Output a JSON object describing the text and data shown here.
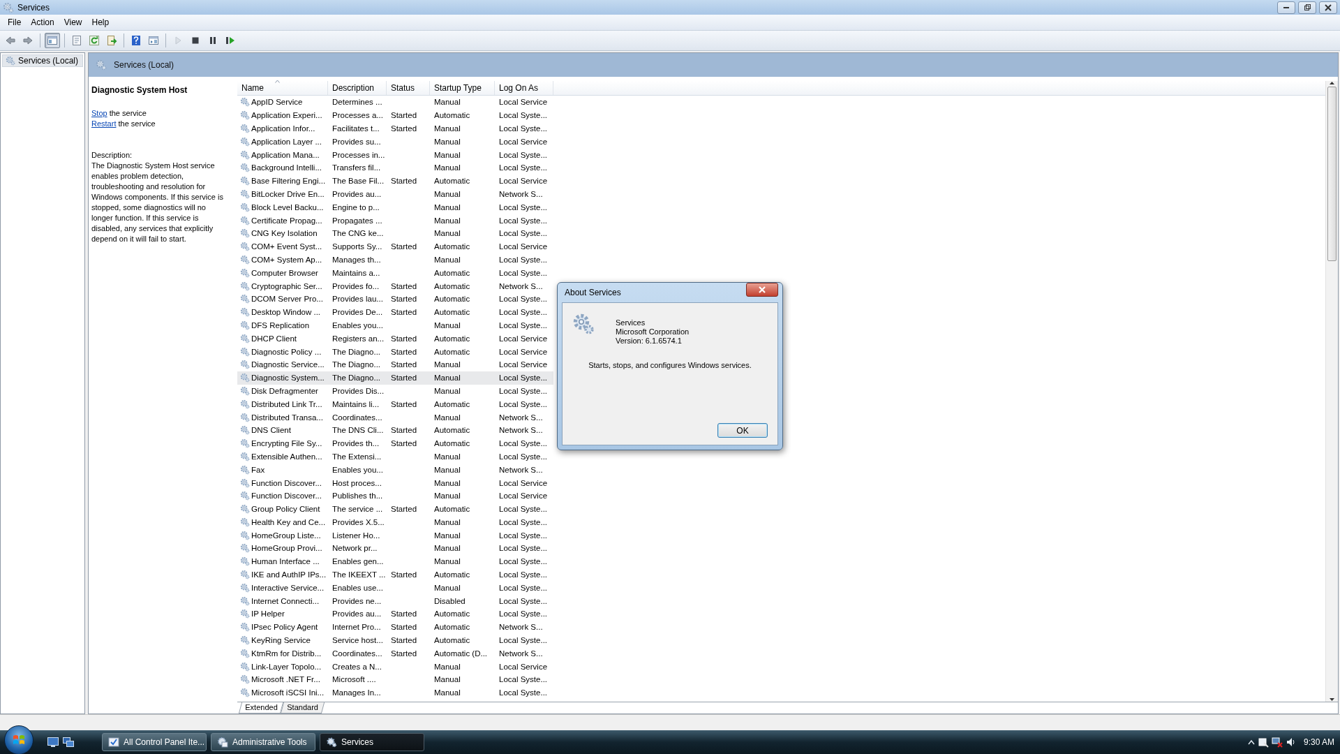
{
  "window": {
    "title": "Services"
  },
  "menu": [
    "File",
    "Action",
    "View",
    "Help"
  ],
  "toolbar": [
    {
      "kind": "back",
      "pressed": false,
      "disabled": false
    },
    {
      "kind": "forward",
      "pressed": false,
      "disabled": false
    },
    {
      "kind": "separator"
    },
    {
      "kind": "tree",
      "pressed": true,
      "disabled": false
    },
    {
      "kind": "separator"
    },
    {
      "kind": "properties",
      "pressed": false,
      "disabled": false
    },
    {
      "kind": "refresh",
      "pressed": false,
      "disabled": false
    },
    {
      "kind": "export",
      "pressed": false,
      "disabled": false
    },
    {
      "kind": "separator"
    },
    {
      "kind": "help",
      "pressed": false,
      "disabled": false
    },
    {
      "kind": "view",
      "pressed": false,
      "disabled": false
    },
    {
      "kind": "separator"
    },
    {
      "kind": "play",
      "pressed": false,
      "disabled": true
    },
    {
      "kind": "stop",
      "pressed": false,
      "disabled": false
    },
    {
      "kind": "pause",
      "pressed": false,
      "disabled": false
    },
    {
      "kind": "restart",
      "pressed": false,
      "disabled": false
    }
  ],
  "tree": {
    "items": [
      {
        "label": "Services (Local)",
        "selected": true
      }
    ]
  },
  "panel": {
    "title": "Services (Local)"
  },
  "detail": {
    "heading": "Diagnostic System Host",
    "actions": [
      {
        "link": "Stop",
        "text": "the service"
      },
      {
        "link": "Restart",
        "text": "the service"
      }
    ],
    "description_label": "Description:",
    "description": "The Diagnostic System Host service enables problem detection, troubleshooting and resolution for Windows components. If this service is stopped, some diagnostics will no longer function. If this service is disabled, any services that explicitly depend on it will fail to start."
  },
  "table": {
    "columns": [
      {
        "label": "Name",
        "sorted": true
      },
      {
        "label": "Description",
        "sorted": false
      },
      {
        "label": "Status",
        "sorted": false
      },
      {
        "label": "Startup Type",
        "sorted": false
      },
      {
        "label": "Log On As",
        "sorted": false
      }
    ],
    "rows": [
      {
        "name": "AppID Service",
        "description": "Determines ...",
        "startup_type": "Manual",
        "log_on_as": "Local Service",
        "selected": false
      },
      {
        "name": "Application Experi...",
        "description": "Processes a...",
        "status": "Started",
        "startup_type": "Automatic",
        "log_on_as": "Local Syste...",
        "selected": false
      },
      {
        "name": "Application Infor...",
        "description": "Facilitates t...",
        "status": "Started",
        "startup_type": "Manual",
        "log_on_as": "Local Syste...",
        "selected": false
      },
      {
        "name": "Application Layer ...",
        "description": "Provides su...",
        "startup_type": "Manual",
        "log_on_as": "Local Service",
        "selected": false
      },
      {
        "name": "Application Mana...",
        "description": "Processes in...",
        "startup_type": "Manual",
        "log_on_as": "Local Syste...",
        "selected": false
      },
      {
        "name": "Background Intelli...",
        "description": "Transfers fil...",
        "startup_type": "Manual",
        "log_on_as": "Local Syste...",
        "selected": false
      },
      {
        "name": "Base Filtering Engi...",
        "description": "The Base Fil...",
        "status": "Started",
        "startup_type": "Automatic",
        "log_on_as": "Local Service",
        "selected": false
      },
      {
        "name": "BitLocker Drive En...",
        "description": "Provides au...",
        "startup_type": "Manual",
        "log_on_as": "Network S...",
        "selected": false
      },
      {
        "name": "Block Level Backu...",
        "description": "Engine to p...",
        "startup_type": "Manual",
        "log_on_as": "Local Syste...",
        "selected": false
      },
      {
        "name": "Certificate Propag...",
        "description": "Propagates ...",
        "startup_type": "Manual",
        "log_on_as": "Local Syste...",
        "selected": false
      },
      {
        "name": "CNG Key Isolation",
        "description": "The CNG ke...",
        "startup_type": "Manual",
        "log_on_as": "Local Syste...",
        "selected": false
      },
      {
        "name": "COM+ Event Syst...",
        "description": "Supports Sy...",
        "status": "Started",
        "startup_type": "Automatic",
        "log_on_as": "Local Service",
        "selected": false
      },
      {
        "name": "COM+ System Ap...",
        "description": "Manages th...",
        "startup_type": "Manual",
        "log_on_as": "Local Syste...",
        "selected": false
      },
      {
        "name": "Computer Browser",
        "description": "Maintains a...",
        "startup_type": "Automatic",
        "log_on_as": "Local Syste...",
        "selected": false
      },
      {
        "name": "Cryptographic Ser...",
        "description": "Provides fo...",
        "status": "Started",
        "startup_type": "Automatic",
        "log_on_as": "Network S...",
        "selected": false
      },
      {
        "name": "DCOM Server Pro...",
        "description": "Provides lau...",
        "status": "Started",
        "startup_type": "Automatic",
        "log_on_as": "Local Syste...",
        "selected": false
      },
      {
        "name": "Desktop Window ...",
        "description": "Provides De...",
        "status": "Started",
        "startup_type": "Automatic",
        "log_on_as": "Local Syste...",
        "selected": false
      },
      {
        "name": "DFS Replication",
        "description": "Enables you...",
        "startup_type": "Manual",
        "log_on_as": "Local Syste...",
        "selected": false
      },
      {
        "name": "DHCP Client",
        "description": "Registers an...",
        "status": "Started",
        "startup_type": "Automatic",
        "log_on_as": "Local Service",
        "selected": false
      },
      {
        "name": "Diagnostic Policy ...",
        "description": "The Diagno...",
        "status": "Started",
        "startup_type": "Automatic",
        "log_on_as": "Local Service",
        "selected": false
      },
      {
        "name": "Diagnostic Service...",
        "description": "The Diagno...",
        "status": "Started",
        "startup_type": "Manual",
        "log_on_as": "Local Service",
        "selected": false
      },
      {
        "name": "Diagnostic System...",
        "description": "The Diagno...",
        "status": "Started",
        "startup_type": "Manual",
        "log_on_as": "Local Syste...",
        "selected": true
      },
      {
        "name": "Disk Defragmenter",
        "description": "Provides Dis...",
        "startup_type": "Manual",
        "log_on_as": "Local Syste...",
        "selected": false
      },
      {
        "name": "Distributed Link Tr...",
        "description": "Maintains li...",
        "status": "Started",
        "startup_type": "Automatic",
        "log_on_as": "Local Syste...",
        "selected": false
      },
      {
        "name": "Distributed Transa...",
        "description": "Coordinates...",
        "startup_type": "Manual",
        "log_on_as": "Network S...",
        "selected": false
      },
      {
        "name": "DNS Client",
        "description": "The DNS Cli...",
        "status": "Started",
        "startup_type": "Automatic",
        "log_on_as": "Network S...",
        "selected": false
      },
      {
        "name": "Encrypting File Sy...",
        "description": "Provides th...",
        "status": "Started",
        "startup_type": "Automatic",
        "log_on_as": "Local Syste...",
        "selected": false
      },
      {
        "name": "Extensible Authen...",
        "description": "The Extensi...",
        "startup_type": "Manual",
        "log_on_as": "Local Syste...",
        "selected": false
      },
      {
        "name": "Fax",
        "description": "Enables you...",
        "startup_type": "Manual",
        "log_on_as": "Network S...",
        "selected": false
      },
      {
        "name": "Function Discover...",
        "description": "Host proces...",
        "startup_type": "Manual",
        "log_on_as": "Local Service",
        "selected": false
      },
      {
        "name": "Function Discover...",
        "description": "Publishes th...",
        "startup_type": "Manual",
        "log_on_as": "Local Service",
        "selected": false
      },
      {
        "name": "Group Policy Client",
        "description": "The service ...",
        "status": "Started",
        "startup_type": "Automatic",
        "log_on_as": "Local Syste...",
        "selected": false
      },
      {
        "name": "Health Key and Ce...",
        "description": "Provides X.5...",
        "startup_type": "Manual",
        "log_on_as": "Local Syste...",
        "selected": false
      },
      {
        "name": "HomeGroup Liste...",
        "description": "Listener Ho...",
        "startup_type": "Manual",
        "log_on_as": "Local Syste...",
        "selected": false
      },
      {
        "name": "HomeGroup Provi...",
        "description": "Network pr...",
        "startup_type": "Manual",
        "log_on_as": "Local Syste...",
        "selected": false
      },
      {
        "name": "Human Interface ...",
        "description": "Enables gen...",
        "startup_type": "Manual",
        "log_on_as": "Local Syste...",
        "selected": false
      },
      {
        "name": "IKE and AuthIP IPs...",
        "description": "The IKEEXT ...",
        "status": "Started",
        "startup_type": "Automatic",
        "log_on_as": "Local Syste...",
        "selected": false
      },
      {
        "name": "Interactive Service...",
        "description": "Enables use...",
        "startup_type": "Manual",
        "log_on_as": "Local Syste...",
        "selected": false
      },
      {
        "name": "Internet Connecti...",
        "description": "Provides ne...",
        "startup_type": "Disabled",
        "log_on_as": "Local Syste...",
        "selected": false
      },
      {
        "name": "IP Helper",
        "description": "Provides au...",
        "status": "Started",
        "startup_type": "Automatic",
        "log_on_as": "Local Syste...",
        "selected": false
      },
      {
        "name": "IPsec Policy Agent",
        "description": "Internet Pro...",
        "status": "Started",
        "startup_type": "Automatic",
        "log_on_as": "Network S...",
        "selected": false
      },
      {
        "name": "KeyRing Service",
        "description": "Service host...",
        "status": "Started",
        "startup_type": "Automatic",
        "log_on_as": "Local Syste...",
        "selected": false
      },
      {
        "name": "KtmRm for Distrib...",
        "description": "Coordinates...",
        "status": "Started",
        "startup_type": "Automatic (D...",
        "log_on_as": "Network S...",
        "selected": false
      },
      {
        "name": "Link-Layer Topolo...",
        "description": "Creates a N...",
        "startup_type": "Manual",
        "log_on_as": "Local Service",
        "selected": false
      },
      {
        "name": "Microsoft .NET Fr...",
        "description": "Microsoft ....",
        "startup_type": "Manual",
        "log_on_as": "Local Syste...",
        "selected": false
      },
      {
        "name": "Microsoft iSCSI Ini...",
        "description": "Manages In...",
        "startup_type": "Manual",
        "log_on_as": "Local Syste...",
        "selected": false
      }
    ]
  },
  "view_tabs": [
    {
      "label": "Extended",
      "selected": true
    },
    {
      "label": "Standard",
      "selected": false
    }
  ],
  "dialog": {
    "title": "About Services",
    "product": "Services",
    "company": "Microsoft Corporation",
    "version": "Version: 6.1.6574.1",
    "summary": "Starts, stops, and configures Windows services.",
    "button": "OK"
  },
  "taskbar": {
    "tasks": [
      {
        "label": "All Control Panel Ite...",
        "kind": "control-panel",
        "selected": false
      },
      {
        "label": "Administrative Tools",
        "kind": "admin-tools",
        "selected": false
      },
      {
        "label": "Services",
        "kind": "services",
        "selected": true
      }
    ],
    "clock": "9:30 AM"
  }
}
